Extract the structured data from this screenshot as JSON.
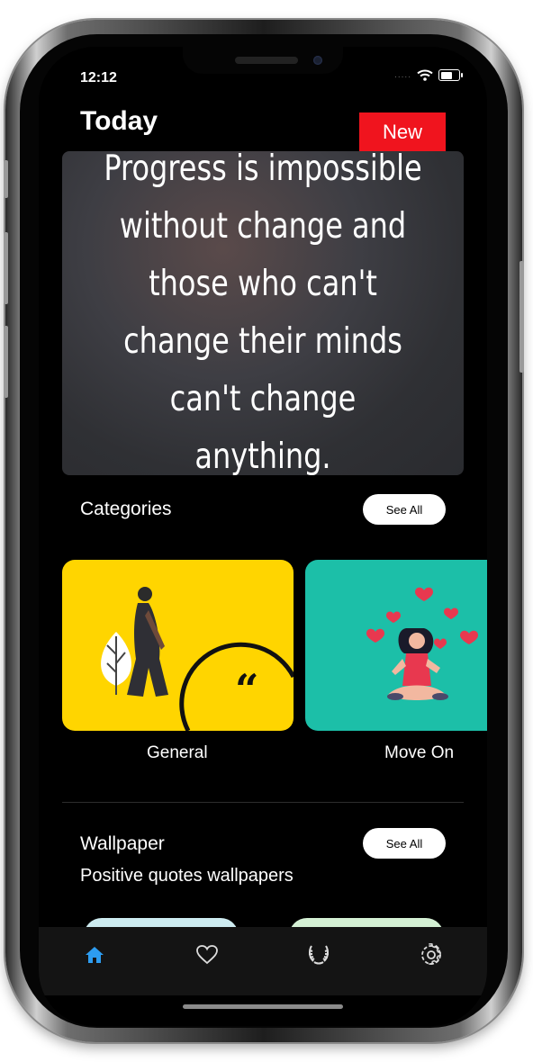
{
  "status_bar": {
    "time": "12:12",
    "signal": "....."
  },
  "header": {
    "title": "Today",
    "badge": "New"
  },
  "quote": {
    "text": "Progress is impossible without change and those who can't change their minds can't change anything."
  },
  "categories": {
    "title": "Categories",
    "see_all": "See All",
    "items": [
      {
        "label": "General",
        "color": "#FFD500"
      },
      {
        "label": "Move On",
        "color": "#1CBFA8"
      }
    ]
  },
  "wallpaper": {
    "title": "Wallpaper",
    "subtitle": "Positive quotes wallpapers",
    "see_all": "See All"
  },
  "tab_bar": {
    "active_color": "#2D9CF0",
    "items": [
      {
        "icon": "home-icon",
        "active": true
      },
      {
        "icon": "heart-icon",
        "active": false
      },
      {
        "icon": "laurel-icon",
        "active": false
      },
      {
        "icon": "gear-icon",
        "active": false
      }
    ]
  }
}
